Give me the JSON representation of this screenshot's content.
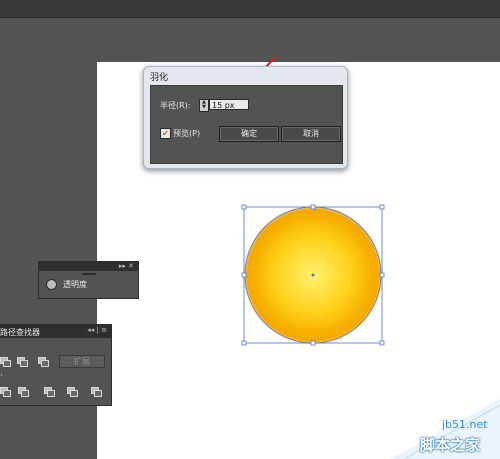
{
  "dialog": {
    "title": "羽化",
    "radius_label": "半径(R):",
    "radius_value": "15 px",
    "preview_label": "预览(P)",
    "preview_checked": true,
    "ok_label": "确定",
    "cancel_label": "取消"
  },
  "transparency_panel": {
    "label": "透明度",
    "controls": "▸▸ ✕"
  },
  "pathfinder_panel": {
    "title": "路径查找器",
    "controls": "◂◂ | ≡",
    "expand_label": "扩展"
  },
  "canvas": {
    "circle_gradient_center": "#ffe86a",
    "circle_gradient_edge": "#f5a800",
    "selection_color": "#4a74d8",
    "annotation_arrow_color": "#e11c1c"
  },
  "watermark": {
    "site": "jb51.net",
    "name": "脚本之家"
  }
}
